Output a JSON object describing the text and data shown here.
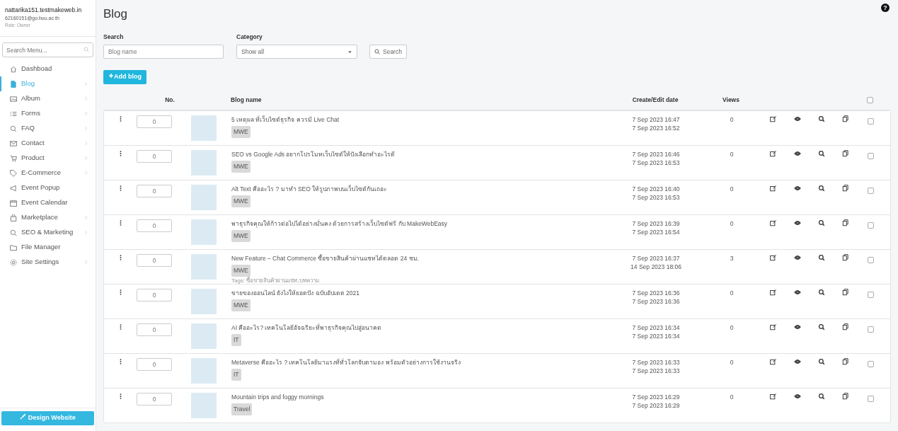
{
  "account": {
    "domain": "nattarika151.testmakeweb.in",
    "email": "62160151@go.buu.ac.th",
    "role": "Role: Owner"
  },
  "sidebar": {
    "search_placeholder": "Search Menu...",
    "items": [
      {
        "label": "Dashboad",
        "selected": false,
        "has_submenu": false
      },
      {
        "label": "Blog",
        "selected": true,
        "has_submenu": true
      },
      {
        "label": "Album",
        "selected": false,
        "has_submenu": true
      },
      {
        "label": "Forms",
        "selected": false,
        "has_submenu": true
      },
      {
        "label": "FAQ",
        "selected": false,
        "has_submenu": true
      },
      {
        "label": "Contact",
        "selected": false,
        "has_submenu": true
      },
      {
        "label": "Product",
        "selected": false,
        "has_submenu": true
      },
      {
        "label": "E-Commerce",
        "selected": false,
        "has_submenu": true
      },
      {
        "label": "Event Popup",
        "selected": false,
        "has_submenu": false
      },
      {
        "label": "Event Calendar",
        "selected": false,
        "has_submenu": false
      },
      {
        "label": "Marketplace",
        "selected": false,
        "has_submenu": true
      },
      {
        "label": "SEO & Marketing",
        "selected": false,
        "has_submenu": true
      },
      {
        "label": "File Manager",
        "selected": false,
        "has_submenu": false
      },
      {
        "label": "Site Settings",
        "selected": false,
        "has_submenu": true
      }
    ],
    "design_button": "Design Website"
  },
  "page": {
    "title": "Blog",
    "help": "?"
  },
  "filters": {
    "search_label": "Search",
    "search_placeholder": "Blog name",
    "category_label": "Category",
    "category_value": "Show all",
    "search_button": "Search"
  },
  "add_button": "Add blog",
  "table": {
    "columns": [
      "No.",
      "Blog name",
      "Create/Edit date",
      "Views"
    ],
    "select_all_checked": false,
    "rows": [
      {
        "no": "0",
        "title": "5 เหตุผล ที่เว็บไซต์ธุรกิจ ควรมี Live Chat",
        "tag": "MWE",
        "created": "7 Sep 2023 16:47",
        "edited": "7 Sep 2023 16:52",
        "views": "0",
        "checked": false
      },
      {
        "no": "0",
        "title": "SEO vs Google Ads อยากโปรโมทเว็บไซต์ให้ปังเลือกทำอะไรดี",
        "tag": "MWE",
        "created": "7 Sep 2023 16:46",
        "edited": "7 Sep 2023 16:53",
        "views": "0",
        "checked": false
      },
      {
        "no": "0",
        "title": "Alt Text คืออะไร ? มาทำ SEO ให้รูปภาพบนเว็บไซต์กันเถอะ",
        "tag": "MWE",
        "created": "7 Sep 2023 16:40",
        "edited": "7 Sep 2023 16:53",
        "views": "0",
        "checked": false
      },
      {
        "no": "0",
        "title": "พาธุรกิจคุณให้ก้าวต่อไปได้อย่างมั่นคง ด้วยการสร้างเว็บไซต์ฟรี กับ MakeWebEasy",
        "tag": "MWE",
        "created": "7 Sep 2023 16:39",
        "edited": "7 Sep 2023 16:54",
        "views": "0",
        "checked": false
      },
      {
        "no": "0",
        "title": "New Feature – Chat Commerce ซื้อขายสินค้าผ่านแชทได้ตลอด 24 ชม.",
        "tag": "MWE",
        "tags_line": "Tags: ซื้อขายสินค้าผ่านแชท,บทความ",
        "created": "7 Sep 2023 16:37",
        "edited": "14 Sep 2023 18:06",
        "views": "3",
        "checked": false
      },
      {
        "no": "0",
        "title": "ขายของออนไลน์ ยังไงให้ยอดปัง ฉบับอัปเดต 2021",
        "tag": "MWE",
        "created": "7 Sep 2023 16:36",
        "edited": "7 Sep 2023 16:36",
        "views": "0",
        "checked": false
      },
      {
        "no": "0",
        "title": "AI คืออะไร? เทคโนโลยีอัจฉริยะที่พาธุรกิจคุณไปสู่อนาคต",
        "tag": "IT",
        "created": "7 Sep 2023 16:34",
        "edited": "7 Sep 2023 16:34",
        "views": "0",
        "checked": false
      },
      {
        "no": "0",
        "title": "Metaverse คืออะไร ? เทคโนโลยีมาแรงที่ทั่วโลกจับตามอง พร้อมตัวอย่างการใช้งานจริง",
        "tag": "IT",
        "created": "7 Sep 2023 16:33",
        "edited": "7 Sep 2023 16:33",
        "views": "0",
        "checked": false
      },
      {
        "no": "0",
        "title": "Mountain trips and foggy mornings",
        "tag": "Travel",
        "created": "7 Sep 2023 16:29",
        "edited": "7 Sep 2023 16:29",
        "views": "0",
        "checked": false
      }
    ]
  }
}
